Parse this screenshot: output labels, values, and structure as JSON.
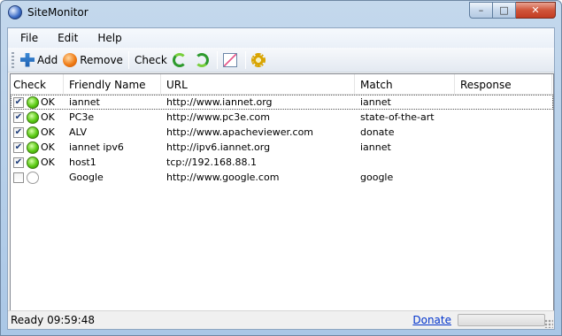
{
  "window": {
    "title": "SiteMonitor"
  },
  "menu": [
    "File",
    "Edit",
    "Help"
  ],
  "toolbar": {
    "add_label": "Add",
    "remove_label": "Remove",
    "check_label": "Check"
  },
  "list": {
    "columns": [
      "Check",
      "Friendly Name",
      "URL",
      "Match",
      "Response"
    ],
    "rows": [
      {
        "checked": true,
        "status": "OK",
        "name": "iannet",
        "url": "http://www.iannet.org",
        "match": "iannet",
        "response": ""
      },
      {
        "checked": true,
        "status": "OK",
        "name": "PC3e",
        "url": "http://www.pc3e.com",
        "match": "state-of-the-art",
        "response": ""
      },
      {
        "checked": true,
        "status": "OK",
        "name": "ALV",
        "url": "http://www.apacheviewer.com",
        "match": "donate",
        "response": ""
      },
      {
        "checked": true,
        "status": "OK",
        "name": "iannet ipv6",
        "url": "http://ipv6.iannet.org",
        "match": "iannet",
        "response": ""
      },
      {
        "checked": true,
        "status": "OK",
        "name": "host1",
        "url": "tcp://192.168.88.1",
        "match": "",
        "response": ""
      },
      {
        "checked": false,
        "status": "",
        "name": "Google",
        "url": "http://www.google.com",
        "match": "google",
        "response": ""
      }
    ]
  },
  "statusbar": {
    "status_text": "Ready 09:59:48",
    "donate_label": "Donate",
    "progress_fraction": 0.0
  },
  "colors": {
    "ok": "#5bcb14",
    "link": "#0033cc"
  }
}
